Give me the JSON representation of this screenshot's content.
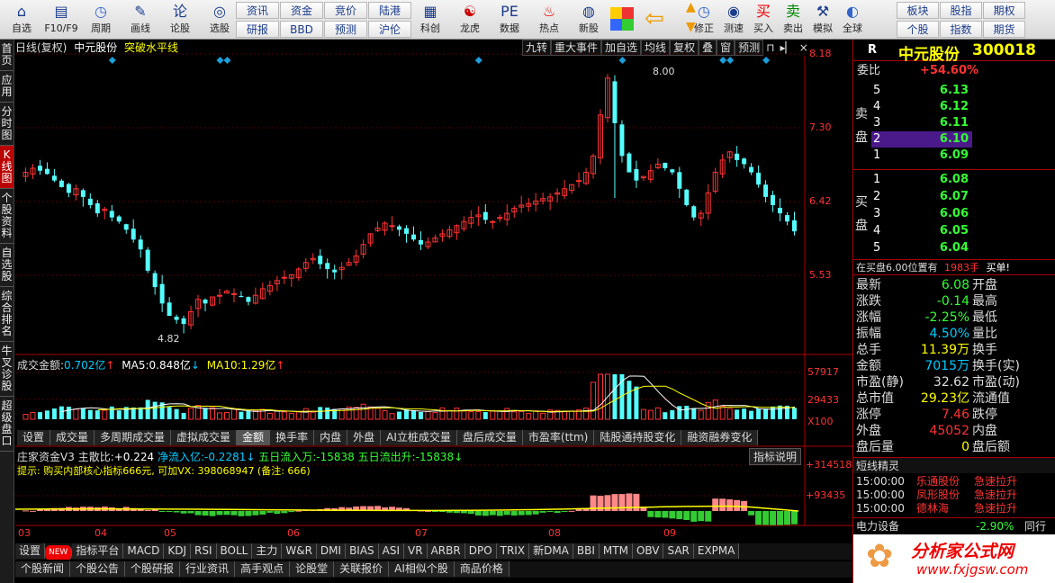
{
  "toolbar": {
    "items": [
      {
        "label": "自选",
        "icon": "home-icon"
      },
      {
        "label": "F10/F9",
        "icon": "f10-icon"
      },
      {
        "label": "周期",
        "icon": "clock-icon"
      },
      {
        "label": "画线",
        "icon": "pencil-icon"
      },
      {
        "label": "论股",
        "icon": "chat-icon"
      },
      {
        "label": "选股",
        "icon": "chart-search-icon"
      }
    ],
    "btns_top": [
      "资讯",
      "资金",
      "竞价",
      "陆港"
    ],
    "btns_bot": [
      "研报",
      "BBD",
      "预测",
      "沪伦"
    ],
    "items2": [
      {
        "label": "科创",
        "icon": "chart-icon"
      },
      {
        "label": "龙虎",
        "icon": "dragon-icon"
      },
      {
        "label": "数据",
        "icon": "pe-icon"
      },
      {
        "label": "热点",
        "icon": "hot-icon"
      },
      {
        "label": "新股",
        "icon": "new-stock-icon"
      }
    ],
    "items3": [
      {
        "label": "修正",
        "icon": "clock-icon"
      },
      {
        "label": "测速",
        "icon": "speed-icon"
      },
      {
        "label": "买入",
        "icon": "buy-icon"
      },
      {
        "label": "卖出",
        "icon": "sell-icon"
      },
      {
        "label": "模拟",
        "icon": "hammer-icon"
      },
      {
        "label": "全球",
        "icon": "globe-icon"
      }
    ],
    "right_top": [
      "板块",
      "股指",
      "期权"
    ],
    "right_bot": [
      "个股",
      "指数",
      "期货"
    ],
    "buy_char": "买",
    "sell_char": "卖"
  },
  "left_tabs": [
    "首页",
    "应用",
    "分时图",
    "K线图",
    "个股资料",
    "自选股",
    "综合排名",
    "牛叉诊股",
    "超级盘口"
  ],
  "chart_header": {
    "title": "日线(复权)",
    "stock": "中元股份",
    "indicator": "突破水平线"
  },
  "chart_buttons": [
    "九转",
    "重大事件",
    "加自选",
    "均线",
    "复权",
    "叠",
    "窗",
    "预测"
  ],
  "price_axis": [
    "8.18",
    "7.30",
    "6.42",
    "5.53"
  ],
  "price_annotations": {
    "high": "8.00",
    "low": "4.82"
  },
  "volume_header": {
    "label": "成交金额:",
    "value": "0.702亿",
    "ma5_label": "MA5:",
    "ma5": "0.848亿",
    "ma10_label": "MA10:",
    "ma10": "1.29亿"
  },
  "volume_axis": [
    "57917",
    "29433",
    "X100"
  ],
  "indicator_tabs": [
    "设置",
    "成交量",
    "多周期成交量",
    "虚拟成交量",
    "金额",
    "换手率",
    "内盘",
    "外盘",
    "AI立桩成交量",
    "盘后成交量",
    "市盈率(ttm)",
    "陆股通持股变化",
    "融资融券变化"
  ],
  "capital": {
    "name": "庄家资金V3",
    "main_label": "主散比:",
    "main": "+0.224",
    "net_label": "净流入亿:",
    "net": "-0.2281",
    "in5_label": "五日流入万:",
    "in5": "-15838",
    "out5_label": "五日流出升:",
    "out5": "-15838",
    "tip": "提示: 购买内部核心指标666元, 可加VX: 398068947 (备注: 666)",
    "explain": "指标说明"
  },
  "capital_axis": [
    "+314518",
    "+93435"
  ],
  "x_axis": [
    "03",
    "04",
    "05",
    "06",
    "07",
    "08",
    "09"
  ],
  "bottom_tabs": [
    "设置",
    "NEW",
    "指标平台",
    "MACD",
    "KDJ",
    "RSI",
    "BOLL",
    "主力",
    "W&R",
    "DMI",
    "BIAS",
    "ASI",
    "VR",
    "ARBR",
    "DPO",
    "TRIX",
    "新DMA",
    "BBI",
    "MTM",
    "OBV",
    "SAR",
    "EXPMA"
  ],
  "news_tabs": [
    "个股新闻",
    "个股公告",
    "个股研报",
    "行业资讯",
    "高手观点",
    "论股堂",
    "关联报价",
    "AI相似个股",
    "商品价格"
  ],
  "quote": {
    "title": "中元股份",
    "code": "300018",
    "mark": "R",
    "weibi_label": "委比",
    "weibi": "+54.60%",
    "sell_label": "卖盘",
    "buy_label": "买盘",
    "sells": [
      {
        "n": "5",
        "p": "6.13"
      },
      {
        "n": "4",
        "p": "6.12"
      },
      {
        "n": "3",
        "p": "6.11"
      },
      {
        "n": "2",
        "p": "6.10"
      },
      {
        "n": "1",
        "p": "6.09"
      }
    ],
    "buys": [
      {
        "n": "1",
        "p": "6.08"
      },
      {
        "n": "2",
        "p": "6.07"
      },
      {
        "n": "3",
        "p": "6.06"
      },
      {
        "n": "4",
        "p": "6.05"
      },
      {
        "n": "5",
        "p": "6.04"
      }
    ],
    "order_note": "在买盘6.00位置有",
    "order_qty": "1983手",
    "order_action": "买单!",
    "stats": [
      {
        "l": "最新",
        "v": "6.08",
        "r": "开盘",
        "vc": "#3f3"
      },
      {
        "l": "涨跌",
        "v": "-0.14",
        "r": "最高",
        "vc": "#3f3"
      },
      {
        "l": "涨幅",
        "v": "-2.25%",
        "r": "最低",
        "vc": "#3f3"
      },
      {
        "l": "振幅",
        "v": "4.50%",
        "r": "量比",
        "vc": "#0cf"
      },
      {
        "l": "总手",
        "v": "11.39万",
        "r": "换手",
        "vc": "#ff0"
      },
      {
        "l": "金额",
        "v": "7015万",
        "r": "换手(实)",
        "vc": "#0cf"
      },
      {
        "l": "市盈(静)",
        "v": "32.62",
        "r": "市盈(动)",
        "vc": "#ddd"
      },
      {
        "l": "总市值",
        "v": "29.23亿",
        "r": "流通值",
        "vc": "#ff0"
      },
      {
        "l": "涨停",
        "v": "7.46",
        "r": "跌停",
        "vc": "#f33"
      },
      {
        "l": "外盘",
        "v": "45052",
        "r": "内盘",
        "vc": "#f33"
      },
      {
        "l": "盘后量",
        "v": "0",
        "r": "盘后额",
        "vc": "#ff0"
      }
    ],
    "flow_title": "短线精灵",
    "flows": [
      {
        "t": "15:00:00",
        "s": "乐通股份",
        "e": "急速拉升"
      },
      {
        "t": "15:00:00",
        "s": "凤形股份",
        "e": "急速拉升"
      },
      {
        "t": "15:00:00",
        "s": "德林海",
        "e": "急速拉升"
      }
    ],
    "sector": "电力设备",
    "sector_chg": "-2.90%",
    "sector_more": "同行",
    "watermark": "分析家公式网",
    "watermark_url": "www.fxjgsw.com"
  },
  "chart_data": {
    "type": "candlestick",
    "x_ticks": [
      "03",
      "04",
      "05",
      "06",
      "07",
      "08",
      "09"
    ],
    "ylim": [
      4.6,
      8.2
    ],
    "close": [
      6.8,
      6.85,
      6.82,
      6.78,
      6.7,
      6.62,
      6.55,
      6.6,
      6.5,
      6.4,
      6.3,
      6.35,
      6.25,
      6.2,
      6.1,
      5.98,
      5.86,
      5.6,
      5.4,
      5.2,
      5.05,
      5.0,
      4.95,
      5.1,
      5.25,
      5.2,
      5.28,
      5.3,
      5.35,
      5.32,
      5.28,
      5.22,
      5.3,
      5.38,
      5.42,
      5.48,
      5.52,
      5.55,
      5.62,
      5.7,
      5.75,
      5.68,
      5.62,
      5.58,
      5.64,
      5.7,
      5.78,
      5.92,
      6.05,
      6.12,
      6.18,
      6.15,
      6.1,
      6.05,
      5.98,
      5.92,
      5.95,
      6.0,
      6.05,
      6.1,
      6.15,
      6.2,
      6.25,
      6.28,
      6.22,
      6.2,
      6.25,
      6.3,
      6.36,
      6.4,
      6.42,
      6.45,
      6.48,
      6.5,
      6.55,
      6.6,
      6.65,
      6.7,
      6.8,
      7.0,
      7.5,
      7.95,
      7.4,
      7.0,
      6.8,
      6.7,
      6.75,
      6.82,
      6.9,
      6.85,
      6.8,
      6.6,
      6.4,
      6.25,
      6.3,
      6.55,
      6.8,
      6.95,
      7.05,
      6.95,
      6.9,
      6.8,
      6.65,
      6.5,
      6.4,
      6.3,
      6.2,
      6.08
    ],
    "volume_ma": [
      "MA5",
      "MA10"
    ]
  }
}
